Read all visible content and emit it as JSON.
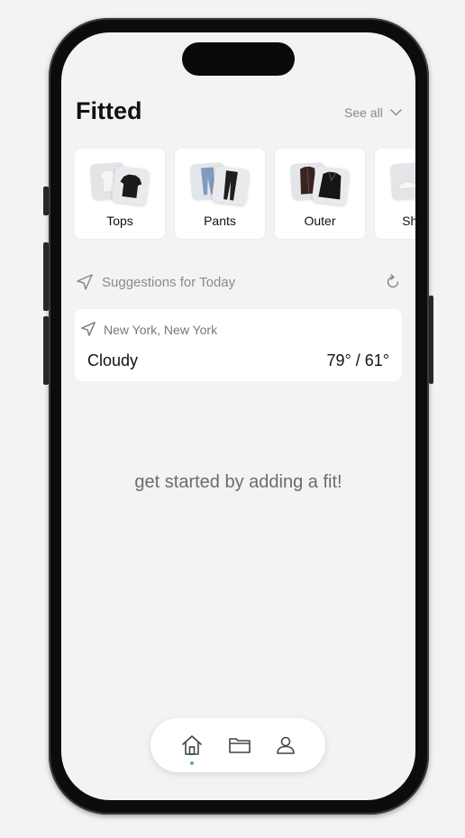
{
  "app": {
    "title": "Fitted",
    "see_all_label": "See all",
    "accent_color": "#4cc463"
  },
  "categories": [
    {
      "label": "Tops",
      "icon": "tshirt-icon"
    },
    {
      "label": "Pants",
      "icon": "jeans-icon"
    },
    {
      "label": "Outer",
      "icon": "jacket-icon"
    },
    {
      "label": "Shoes",
      "icon": "shoe-icon"
    }
  ],
  "suggestions": {
    "heading": "Suggestions for Today",
    "refresh_icon": "refresh-icon"
  },
  "weather": {
    "location": "New York, New York",
    "condition": "Cloudy",
    "temperature": "79° / 61°"
  },
  "empty_state": {
    "message": "get started by adding a fit!"
  },
  "tab_bar": {
    "items": [
      {
        "icon": "home-icon",
        "active": true
      },
      {
        "icon": "folder-icon",
        "active": false
      },
      {
        "icon": "person-icon",
        "active": false
      }
    ]
  }
}
